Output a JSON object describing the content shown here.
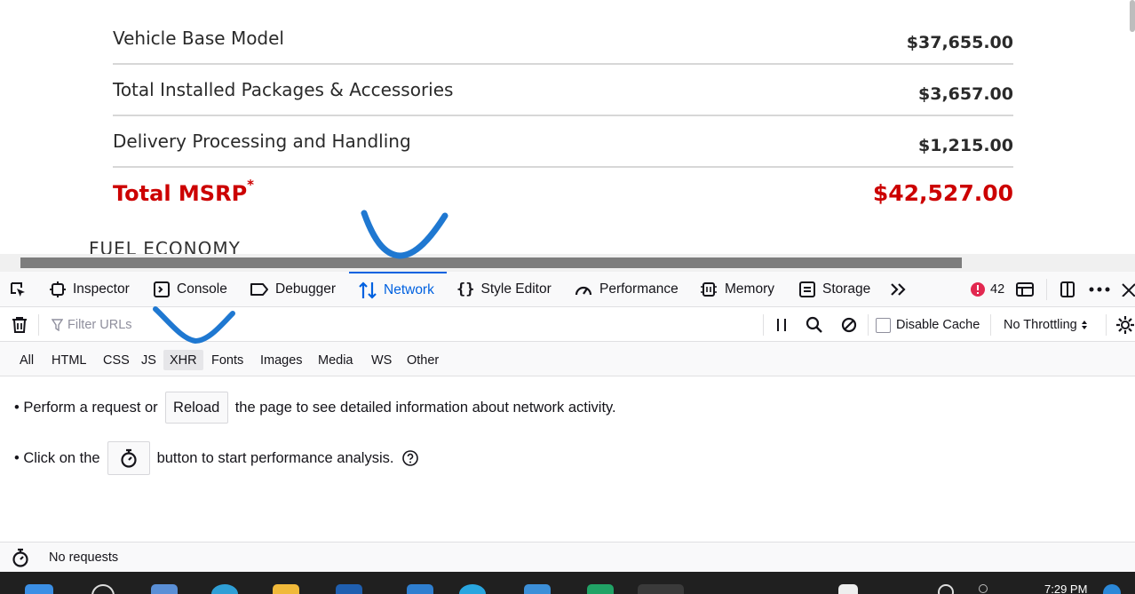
{
  "webpage": {
    "price_rows": [
      {
        "label": "Vehicle Base Model",
        "value": "$37,655.00"
      },
      {
        "label": "Total Installed Packages & Accessories",
        "value": "$3,657.00"
      },
      {
        "label": "Delivery Processing and Handling",
        "value": "$1,215.00"
      }
    ],
    "total": {
      "label": "Total MSRP",
      "asterisk": "*",
      "value": "$42,527.00"
    },
    "next_section": "FUEL ECONOMY"
  },
  "devtools": {
    "tabs": [
      {
        "label": "Inspector",
        "icon": "inspector-icon"
      },
      {
        "label": "Console",
        "icon": "console-icon"
      },
      {
        "label": "Debugger",
        "icon": "debugger-icon"
      },
      {
        "label": "Network",
        "icon": "network-icon",
        "active": true
      },
      {
        "label": "Style Editor",
        "icon": "style-editor-icon"
      },
      {
        "label": "Performance",
        "icon": "performance-icon"
      },
      {
        "label": "Memory",
        "icon": "memory-icon"
      },
      {
        "label": "Storage",
        "icon": "storage-icon"
      }
    ],
    "error_count": "42",
    "accent_color": "#0061e0",
    "toolbar": {
      "filter_placeholder": "Filter URLs",
      "disable_cache_label": "Disable Cache",
      "disable_cache_checked": false,
      "throttling": "No Throttling"
    },
    "request_types": [
      {
        "label": "All"
      },
      {
        "label": "HTML"
      },
      {
        "label": "CSS"
      },
      {
        "label": "JS"
      },
      {
        "label": "XHR",
        "selected": true
      },
      {
        "label": "Fonts"
      },
      {
        "label": "Images"
      },
      {
        "label": "Media"
      },
      {
        "label": "WS"
      },
      {
        "label": "Other"
      }
    ],
    "empty_state": {
      "line1_before": "• Perform a request or",
      "reload_button": "Reload",
      "line1_after": "the page to see detailed information about network activity.",
      "line2_before": "• Click on the",
      "line2_after": "button to start performance analysis."
    },
    "status": "No requests"
  },
  "taskbar": {
    "clock": "7:29 PM"
  }
}
